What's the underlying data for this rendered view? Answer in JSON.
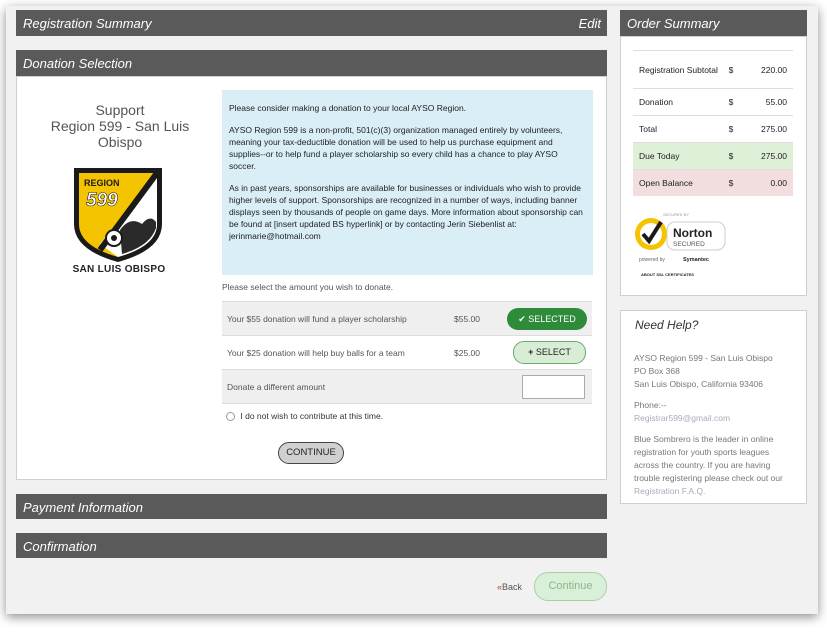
{
  "sections": {
    "registration_summary": "Registration Summary",
    "edit": "Edit",
    "donation_selection": "Donation Selection",
    "payment_information": "Payment Information",
    "confirmation": "Confirmation"
  },
  "support": {
    "line1": "Support",
    "line2": "Region 599 - San Luis",
    "line3": "Obispo",
    "logo_region": "REGION",
    "logo_number": "599",
    "logo_caption": "SAN LUIS OBISPO"
  },
  "info": {
    "p1": "Please consider making a donation to your local AYSO Region.",
    "p2": "AYSO Region 599 is a non-profit, 501(c)(3) organization managed entirely by volunteers, meaning your tax-deductible donation will be used to help us purchase equipment and supplies--or to help fund a player scholarship so every child has a chance to play AYSO soccer.",
    "p3": "As in past years, sponsorships are available for businesses or individuals who wish to provide higher levels of support. Sponsorships are recognized in a number of ways, including banner displays seen by thousands of people on game days. More information about sponsorship can be found at [insert updated BS hyperlink] or by contacting Jerin Siebenlist at:  jerinmarie@hotmail.com"
  },
  "donation": {
    "hint": "Please select the amount you wish to donate.",
    "option1_label": "Your $55 donation will fund a player scholarship",
    "option1_amount": "$55.00",
    "option1_button": "SELECTED",
    "option2_label": "Your $25 donation will help buy balls for a team",
    "option2_amount": "$25.00",
    "option2_button": "SELECT",
    "other_label": "Donate a different amount",
    "other_value": "",
    "optout": "I do not wish to contribute at this time.",
    "continue": "CONTINUE"
  },
  "nav": {
    "back": "Back",
    "continue": "Continue"
  },
  "order_summary": {
    "title": "Order Summary",
    "rows": [
      {
        "label": "Registration Subtotal",
        "currency": "$",
        "amount": "220.00"
      },
      {
        "label": "Donation",
        "currency": "$",
        "amount": "55.00"
      },
      {
        "label": "Total",
        "currency": "$",
        "amount": "275.00"
      },
      {
        "label": "Due Today",
        "currency": "$",
        "amount": "275.00"
      },
      {
        "label": "Open Balance",
        "currency": "$",
        "amount": "0.00"
      }
    ],
    "norton": {
      "top": "SECURED BY",
      "name": "Norton",
      "secured": "SECURED",
      "powered": "powered by",
      "brand": "Symantec",
      "about": "ABOUT SSL CERTIFICATES"
    }
  },
  "help": {
    "title": "Need Help?",
    "org": "AYSO Region 599 - San Luis Obispo",
    "box": "PO Box 368",
    "city": "San Luis Obispo, California 93406",
    "phone": "Phone:--",
    "email": "Registrar599@gmail.com",
    "blurb": "Blue Sombrero is the leader in online registration for youth sports leagues across the country. If you are having trouble registering please check out our",
    "faq": "Registration F.A.Q."
  },
  "colors": {
    "header_bar": "#5a5a5a",
    "info_bg": "#daeef8",
    "selected_green": "#2e8b3a",
    "due_today_bg": "#dff0d8",
    "open_balance_bg": "#f2dede",
    "norton_yellow": "#f5c400"
  }
}
